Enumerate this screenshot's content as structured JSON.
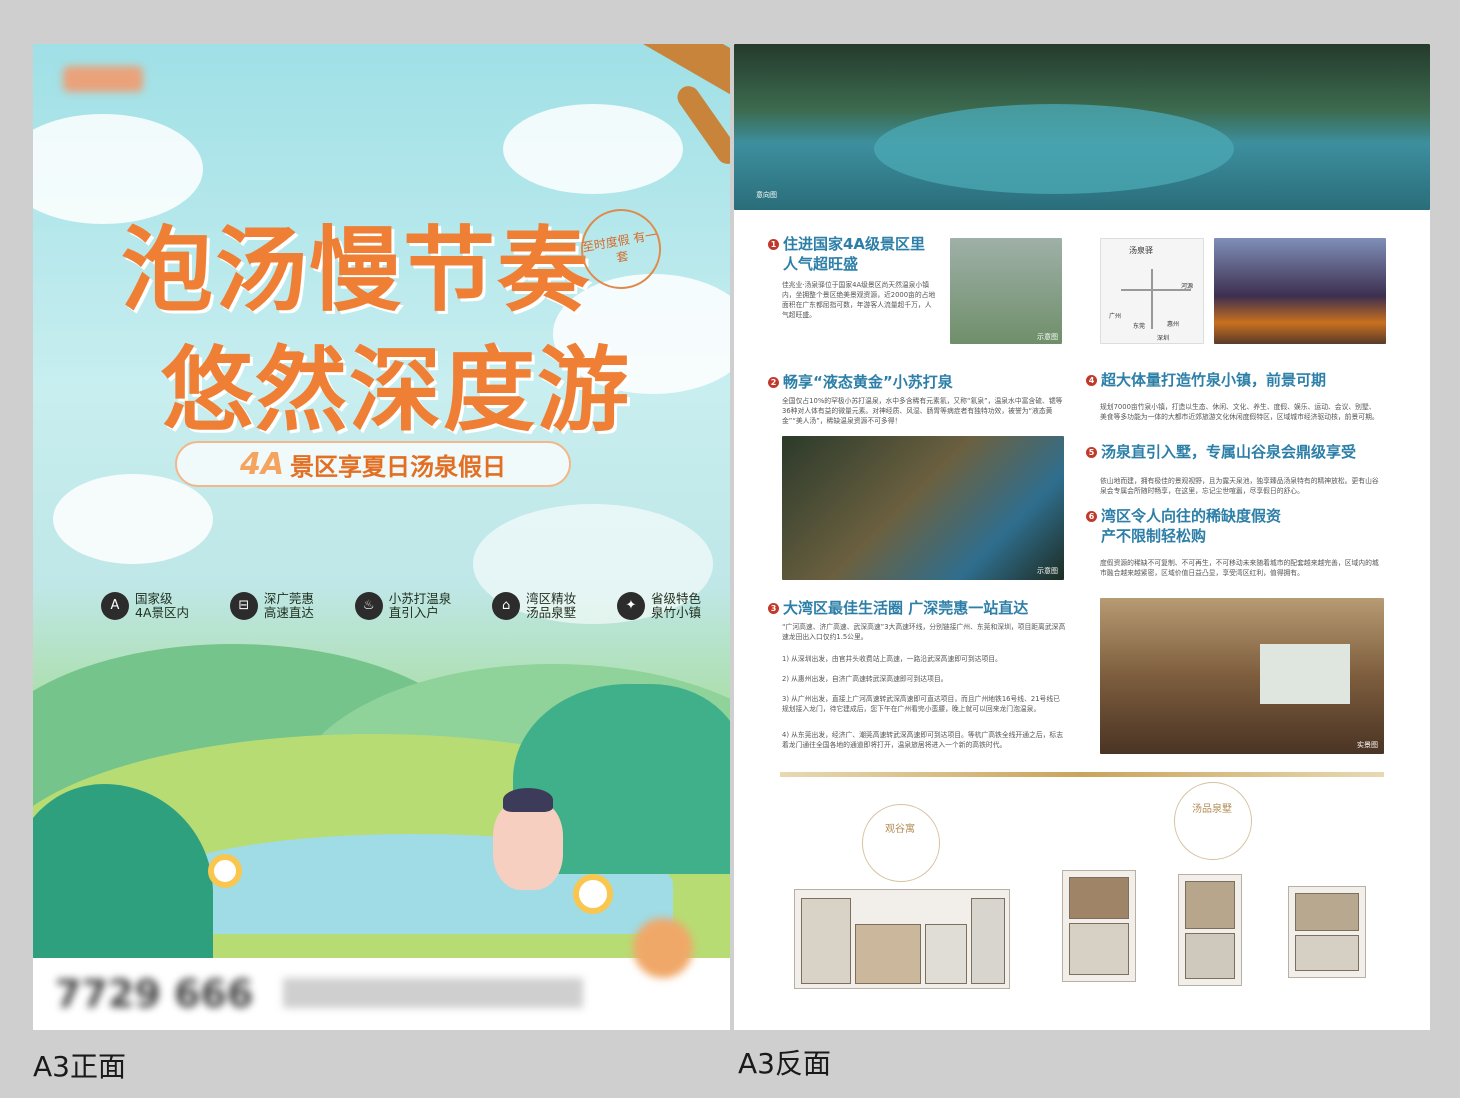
{
  "front": {
    "title_line1": "泡汤慢节奏",
    "title_line2": "悠然深度游",
    "stamp_text": "至时度假 有一套",
    "ribbon_big": "4A",
    "ribbon_text": "景区享夏日汤泉假日",
    "features": [
      {
        "icon": "aaaa-badge-icon",
        "glyph": "A",
        "line1": "国家级",
        "line2": "4A景区内"
      },
      {
        "icon": "highway-icon",
        "glyph": "⊟",
        "line1": "深广莞惠",
        "line2": "高速直达"
      },
      {
        "icon": "hot-spring-icon",
        "glyph": "♨",
        "line1": "小苏打温泉",
        "line2": "直引入户"
      },
      {
        "icon": "house-icon",
        "glyph": "⌂",
        "line1": "湾区精妆",
        "line2": "汤品泉墅"
      },
      {
        "icon": "bamboo-icon",
        "glyph": "✦",
        "line1": "省级特色",
        "line2": "泉竹小镇"
      }
    ],
    "phone": "7729 666"
  },
  "back": {
    "photo_tag": "意向图",
    "s1": {
      "num": "1",
      "title_l1": "住进国家4A级景区里",
      "title_l2": "人气超旺盛",
      "body": "佳兆业·汤泉驿位于国家4A级景区尚天然温泉小镇内，坐拥整个景区绝美景观资源，近2000亩的占地面积在广东都屈指可数，年游客人流量超千万，人气超旺盛。"
    },
    "s2": {
      "num": "2",
      "title": "畅享“液态黄金”小苏打泉",
      "body": "全国仅占10%的罕极小苏打温泉，水中多含稀有元素氡，又称“氡泉”，温泉水中富含硫、锶等36种对人体有益的微量元素。对神经质、风湿、肠胃等病症者有独特功效，被誉为“液态黄金”“美人汤”，稀缺温泉资源不可多得！"
    },
    "s3": {
      "num": "3",
      "title": "大湾区最佳生活圈 广深莞惠一站直达",
      "body0": "“广河高速、济广高速、武深高速”3大高速环线，分别链接广州、东莞和深圳，项目距离武深高速龙田出入口仅约1.5公里。",
      "body1": "1) 从深圳出发，由官井头收费站上高速，一路沿武深高速即可到达项目。",
      "body2": "2) 从惠州出发，自济广高速转武深高速即可到达项目。",
      "body3": "3) 从广州出发，直接上广河高速转武深高速即可直达项目，而且广州地铁16号线、21号线已规划接入龙门，待它建成后，您下午在广州看完小蛮腰，晚上就可以回来龙门泡温泉。",
      "body4": "4) 从东莞出发，经济广、潮莞高速转武深高速即可到达项目。等杭广高铁全线开通之后，标志着龙门通往全国各地的通道即将打开，温泉旅居将进入一个新的高铁时代。"
    },
    "s4": {
      "num": "4",
      "title": "超大体量打造竹泉小镇，前景可期",
      "body": "规划7000亩竹泉小镇，打造以生态、休闲、文化、养生、度假、娱乐、运动、会议、别墅、美食等多功能为一体的大都市近郊旅游文化休闲度假特区，区域城市经济驱动核，前景可期。"
    },
    "s5": {
      "num": "5",
      "title": "汤泉直引入墅，专属山谷泉会鼎级享受",
      "body": "依山地而建，拥有极佳的景观视野，且为露天泉池，独享臻品汤泉特有的精神放松。更有山谷泉会专属会所随时畅享，在这里，忘记尘世喧嚣，尽享假日的舒心。"
    },
    "s6": {
      "num": "6",
      "title_l1": "湾区令人向往的稀缺度假资",
      "title_l2": "产不限制轻松购",
      "body": "度假资源的稀缺不可复制、不可再生，不可移动未来随着城市的配套越来越完善，区域内的城市融合越来越紧密，区域价值日益凸显，享受湾区红利，值得拥有。"
    },
    "map_labels": [
      "汤泉驿",
      "河源",
      "广州",
      "东莞",
      "惠州",
      "深圳"
    ],
    "plan_left_label": "观谷寓",
    "plan_right_label": "汤品泉墅",
    "img_tags": {
      "t1": "示意图",
      "t2": "示意图",
      "t3": "实景图"
    }
  },
  "captions": {
    "front": "A3正面",
    "back": "A3反面"
  }
}
